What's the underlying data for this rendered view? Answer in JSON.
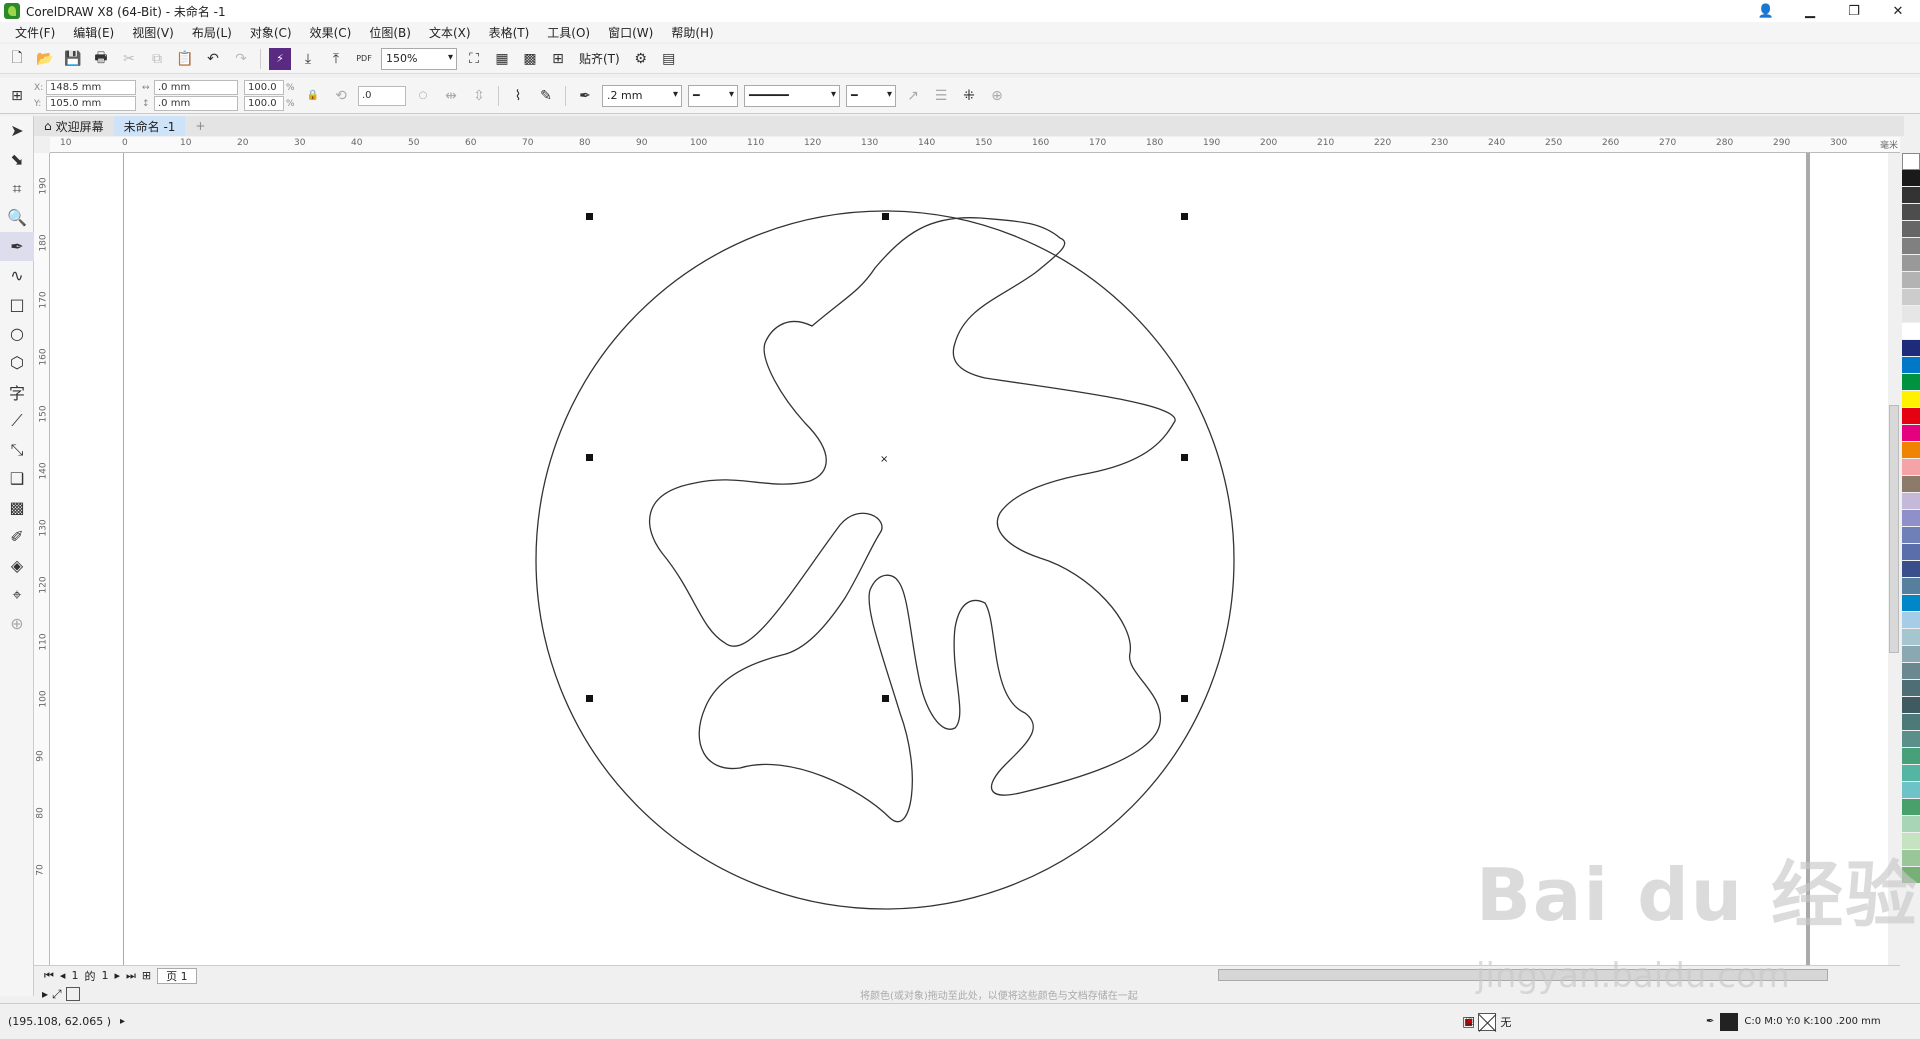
{
  "window": {
    "title": "CorelDRAW X8 (64-Bit) - 未命名 -1"
  },
  "menu": [
    "文件(F)",
    "编辑(E)",
    "视图(V)",
    "布局(L)",
    "对象(C)",
    "效果(C)",
    "位图(B)",
    "文本(X)",
    "表格(T)",
    "工具(O)",
    "窗口(W)",
    "帮助(H)"
  ],
  "toolbar": {
    "zoom": "150%",
    "snap_label": "贴齐(T)",
    "pdf_label": "PDF"
  },
  "props": {
    "x": "148.5 mm",
    "y": "105.0 mm",
    "w": ".0 mm",
    "h": ".0 mm",
    "sx": "100.0",
    "sy": "100.0",
    "pct": "%",
    "rotation": ".0",
    "outline_width": ".2 mm"
  },
  "tabs": {
    "welcome": "欢迎屏幕",
    "doc": "未命名 -1",
    "plus": "+"
  },
  "ruler_h": [
    "10",
    "0",
    "10",
    "20",
    "30",
    "40",
    "50",
    "60",
    "70",
    "80",
    "90",
    "100",
    "110",
    "120",
    "130",
    "140",
    "150",
    "160",
    "170",
    "180",
    "190",
    "200",
    "210",
    "220",
    "230",
    "240",
    "250",
    "260",
    "270",
    "280",
    "290",
    "300",
    "毫米"
  ],
  "ruler_v": [
    "190",
    "180",
    "170",
    "160",
    "150",
    "140",
    "130",
    "120",
    "110",
    "100",
    "90",
    "80",
    "70"
  ],
  "pages": {
    "current": "1",
    "of_label": "的",
    "total": "1",
    "page_tab": "页 1"
  },
  "dropbar": {
    "hint": "将颜色(或对象)拖动至此处，以便将这些颜色与文档存储在一起"
  },
  "status": {
    "coords": "(195.108, 62.065 )",
    "fill_label": "无",
    "outline_info": "C:0 M:0 Y:0 K:100  .200 mm"
  },
  "watermark": {
    "big": "Bai du 经验",
    "small": "jingyan.baidu.com"
  },
  "palette": [
    "#1a1a1a",
    "#333333",
    "#4d4d4d",
    "#666666",
    "#808080",
    "#999999",
    "#b3b3b3",
    "#cccccc",
    "#e6e6e6",
    "#ffffff",
    "#1e2a7a",
    "#0078c8",
    "#00923f",
    "#fff100",
    "#e50012",
    "#e4007f",
    "#f08300",
    "#f5a3a6",
    "#8c7b6b",
    "#c5b9d9",
    "#8f8fc9",
    "#6f7fb8",
    "#5a6eab",
    "#3b4e8c",
    "#567f9e",
    "#0087c8",
    "#a5cde8",
    "#a6c6cf",
    "#8aa8b0",
    "#6b8890",
    "#4f6d75",
    "#3f5a60",
    "#4b7a78",
    "#5a9089",
    "#48a07a",
    "#55b5a3",
    "#6ec3c9",
    "#4aa06a",
    "#a8d5b5",
    "#c5e3c0",
    "#9ac79a",
    "#76b076"
  ]
}
